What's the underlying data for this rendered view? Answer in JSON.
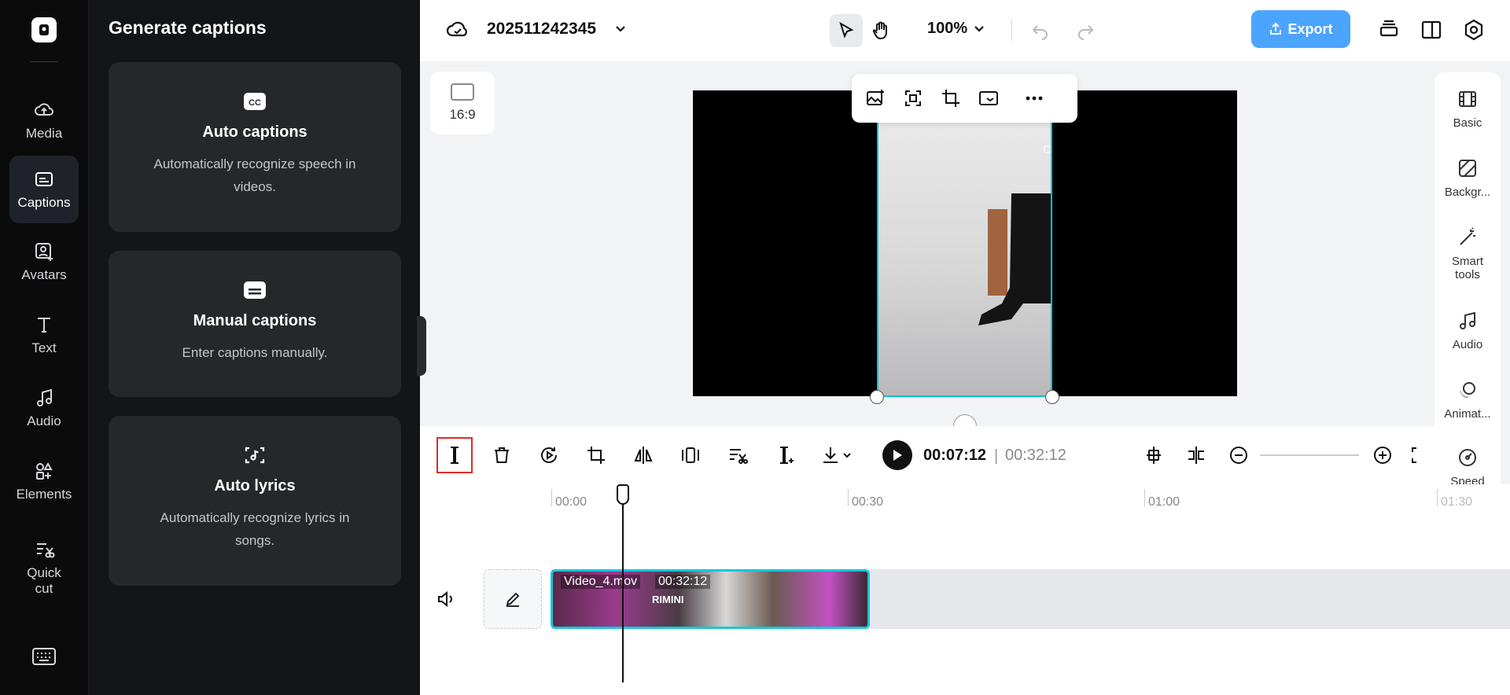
{
  "left_rail": {
    "items": [
      {
        "label": "Media",
        "icon": "cloud-upload-icon"
      },
      {
        "label": "Captions",
        "icon": "captions-icon",
        "active": true
      },
      {
        "label": "Avatars",
        "icon": "avatar-icon"
      },
      {
        "label": "Text",
        "icon": "text-icon"
      },
      {
        "label": "Audio",
        "icon": "music-note-icon"
      },
      {
        "label": "Elements",
        "icon": "elements-icon"
      },
      {
        "label": "Quick cut",
        "icon": "quick-cut-icon"
      }
    ]
  },
  "panel": {
    "title": "Generate captions",
    "cards": [
      {
        "title": "Auto captions",
        "desc": "Automatically recognize speech in videos."
      },
      {
        "title": "Manual captions",
        "desc": "Enter captions manually."
      },
      {
        "title": "Auto lyrics",
        "desc": "Automatically recognize lyrics in songs."
      }
    ]
  },
  "topbar": {
    "project_name": "202511242345",
    "zoom": "100%",
    "export_label": "Export"
  },
  "canvas": {
    "ratio_label": "16:9"
  },
  "right_rail": {
    "items": [
      "Basic",
      "Backgr...",
      "Smart tools",
      "Audio",
      "Animat...",
      "Speed"
    ]
  },
  "timeline_toolbar": {
    "current_time": "00:07:12",
    "total_time": "00:32:12"
  },
  "timeline": {
    "ticks": [
      "00:00",
      "00:30",
      "01:00",
      "01:30"
    ],
    "clip_name": "Video_4.mov",
    "clip_duration": "00:32:12",
    "clip_overlay_text": "RIMINI"
  },
  "colors": {
    "accent": "#4ba4ff",
    "clip_border": "#16c7dd",
    "highlight_box": "#e12a2a"
  }
}
